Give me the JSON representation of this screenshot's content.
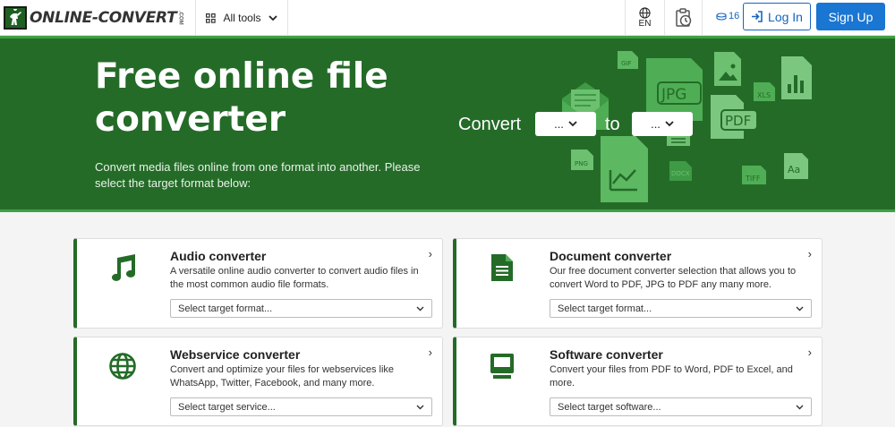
{
  "header": {
    "logo_text": "ONLINE-CONVERT",
    "logo_suffix": ".COM",
    "all_tools_label": "All tools",
    "language": "EN",
    "credits": "16",
    "login_label": "Log In",
    "signup_label": "Sign Up"
  },
  "hero": {
    "title": "Free online file converter",
    "subtitle": "Convert media files online from one format into another. Please select the target format below:",
    "convert_label": "Convert",
    "to_label": "to",
    "from_select": "...",
    "to_select": "...",
    "file_types": [
      "GIF",
      "JPG",
      "XLS",
      "PDF",
      "PNG",
      "DOCX",
      "TIFF",
      "Aa"
    ]
  },
  "cards": [
    {
      "title": "Audio converter",
      "description": "A versatile online audio converter to convert audio files in the most common audio file formats.",
      "select": "Select target format..."
    },
    {
      "title": "Document converter",
      "description": "Our free document converter selection that allows you to convert Word to PDF, JPG to PDF any many more.",
      "select": "Select target format..."
    },
    {
      "title": "Webservice converter",
      "description": "Convert and optimize your files for webservices like WhatsApp, Twitter, Facebook, and many more.",
      "select": "Select target service..."
    },
    {
      "title": "Software converter",
      "description": "Convert your files from PDF to Word, PDF to Excel, and more.",
      "select": "Select target software..."
    }
  ],
  "colors": {
    "brand_green": "#246b28",
    "accent_green": "#3fa046",
    "icon_green": "#6cc070",
    "link_blue": "#1565c0",
    "button_blue": "#1976d2"
  }
}
